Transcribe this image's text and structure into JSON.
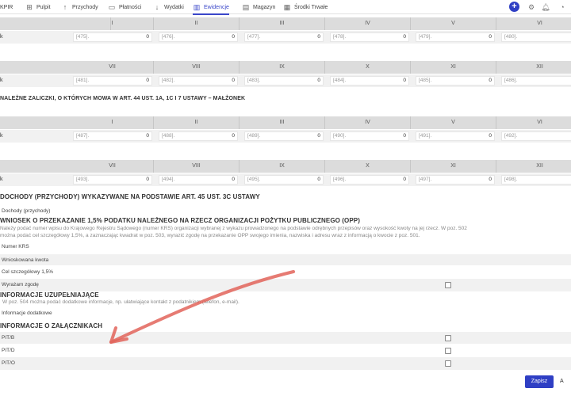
{
  "nav": {
    "tabs": [
      {
        "label": "KPIR",
        "icon": "none"
      },
      {
        "label": "Pulpit",
        "icon": "grid-icon"
      },
      {
        "label": "Przychody",
        "icon": "arrow-up-icon"
      },
      {
        "label": "Płatności",
        "icon": "card-icon"
      },
      {
        "label": "Wydatki",
        "icon": "arrow-down-icon"
      },
      {
        "label": "Ewidencje",
        "icon": "bar-chart-icon"
      },
      {
        "label": "Magazyn",
        "icon": "box-icon"
      },
      {
        "label": "Środki Trwałe",
        "icon": "building-icon"
      }
    ],
    "active_tab": "Ewidencje",
    "add_symbol": "+",
    "accent": "#3a46c9"
  },
  "row_label": "k",
  "grid1": {
    "headers_a": [
      "I",
      "II",
      "III",
      "IV",
      "V",
      "VI"
    ],
    "fields_a": [
      {
        "code": "[475].",
        "value": "0"
      },
      {
        "code": "[476].",
        "value": "0"
      },
      {
        "code": "[477].",
        "value": "0"
      },
      {
        "code": "[478].",
        "value": "0"
      },
      {
        "code": "[479].",
        "value": "0"
      },
      {
        "code": "[480].",
        "value": ""
      }
    ],
    "headers_b": [
      "VII",
      "VIII",
      "IX",
      "X",
      "XI",
      "XII"
    ],
    "fields_b": [
      {
        "code": "[481].",
        "value": "0"
      },
      {
        "code": "[482].",
        "value": "0"
      },
      {
        "code": "[483].",
        "value": "0"
      },
      {
        "code": "[484].",
        "value": "0"
      },
      {
        "code": "[485].",
        "value": "0"
      },
      {
        "code": "[486].",
        "value": ""
      }
    ]
  },
  "section_malzonek": "NALEŻNE ZALICZKI, O KTÓRYCH MOWA W ART. 44 UST. 1A, 1C I 7 USTAWY – MAŁŻONEK",
  "grid2": {
    "headers_a": [
      "I",
      "II",
      "III",
      "IV",
      "V",
      "VI"
    ],
    "fields_a": [
      {
        "code": "[487].",
        "value": "0"
      },
      {
        "code": "[488].",
        "value": "0"
      },
      {
        "code": "[489].",
        "value": "0"
      },
      {
        "code": "[490].",
        "value": "0"
      },
      {
        "code": "[491].",
        "value": "0"
      },
      {
        "code": "[492].",
        "value": ""
      }
    ],
    "headers_b": [
      "VII",
      "VIII",
      "IX",
      "X",
      "XI",
      "XII"
    ],
    "fields_b": [
      {
        "code": "[493].",
        "value": "0"
      },
      {
        "code": "[494].",
        "value": "0"
      },
      {
        "code": "[495].",
        "value": "0"
      },
      {
        "code": "[496].",
        "value": "0"
      },
      {
        "code": "[497].",
        "value": "0"
      },
      {
        "code": "[498].",
        "value": ""
      }
    ]
  },
  "section_dochody": "DOCHODY (PRZYCHODY) WYKAZYWANE NA PODSTAWIE ART. 45 UST. 3C USTAWY",
  "dochody_label": "Dochody (przychody)",
  "section_opp": "WNIOSEK O PRZEKAZANIE 1,5% PODATKU NALEŻNEGO NA RZECZ ORGANIZACJI POŻYTKU PUBLICZNEGO (OPP)",
  "opp_text_1": "Należy podać numer wpisu do Krajowego Rejestru Sądowego (numer KRS) organizacji wybranej z wykazu prowadzonego na podstawie odrębnych przepisów oraz wysokość kwoty na jej rzecz. W poz. 502",
  "opp_text_2": "można podać cel szczegółowy 1,5%, a zaznaczając kwadrat w poz. 503, wyrazić zgodę na przekazanie OPP swojego imienia, nazwiska i adresu wraz z informacją o kwocie z poz. 501.",
  "opp_rows": [
    "Numer KRS",
    "Wnioskowana kwota",
    "Cel szczegółowy 1,5%",
    "Wyrażam zgodę"
  ],
  "section_info": "INFORMACJE UZUPEŁNIAJĄCE",
  "info_text": "W poz. 504 można podać dodatkowe informacje, np. ułatwiające kontakt z podatnikiem (telefon, e-mail).",
  "info_row": "Informacje dodatkowe",
  "section_attach": "INFORMACJE O ZAŁĄCZNIKACH",
  "attach_rows": [
    "PIT/B",
    "PIT/D",
    "PIT/O"
  ],
  "buttons": {
    "save": "Zapisz",
    "next": "A"
  },
  "annotation_arrow_color": "#e2645a"
}
